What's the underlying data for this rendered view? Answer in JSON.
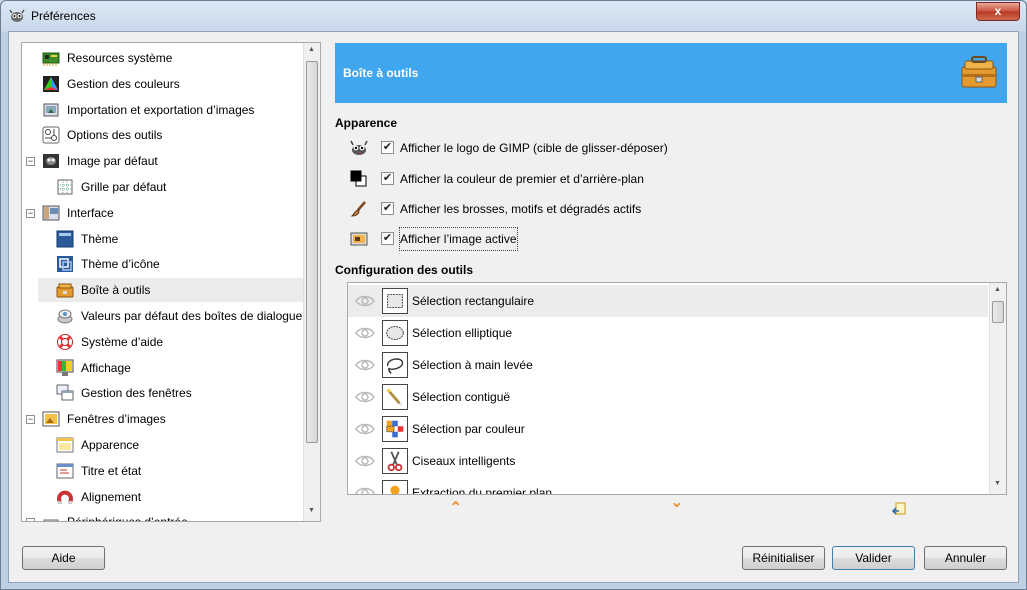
{
  "window": {
    "title": "Préférences",
    "close_label": "x"
  },
  "tree": {
    "items": [
      {
        "label": "Resources système",
        "icon": "chip-icon"
      },
      {
        "label": "Gestion des couleurs",
        "icon": "color-management-icon"
      },
      {
        "label": "Importation et exportation d’images",
        "icon": "import-export-icon"
      },
      {
        "label": "Options des outils",
        "icon": "tool-options-icon"
      },
      {
        "label": "Image par défaut",
        "icon": "default-image-icon",
        "expander": "−"
      },
      {
        "label": "Grille par défaut",
        "icon": "grid-icon"
      },
      {
        "label": "Interface",
        "icon": "interface-icon",
        "expander": "−"
      },
      {
        "label": "Thème",
        "icon": "theme-icon"
      },
      {
        "label": "Thème d’icône",
        "icon": "icon-theme-icon"
      },
      {
        "label": "Boîte à outils",
        "icon": "toolbox-icon",
        "selected": true
      },
      {
        "label": "Valeurs par défaut des boîtes de dialogue",
        "icon": "dialog-defaults-icon"
      },
      {
        "label": "Système d’aide",
        "icon": "help-lifebuoy-icon"
      },
      {
        "label": "Affichage",
        "icon": "display-icon"
      },
      {
        "label": "Gestion des fenêtres",
        "icon": "window-management-icon"
      },
      {
        "label": "Fenêtres d’images",
        "icon": "image-windows-icon",
        "expander": "−"
      },
      {
        "label": "Apparence",
        "icon": "appearance-icon"
      },
      {
        "label": "Titre et état",
        "icon": "title-status-icon"
      },
      {
        "label": "Alignement",
        "icon": "magnet-icon"
      },
      {
        "label": "Périphériques d’entrée",
        "icon": "input-devices-icon",
        "expander": "−"
      }
    ]
  },
  "banner": {
    "title": "Boîte à outils",
    "icon": "toolbox-icon",
    "color": "#3fa6ef"
  },
  "appearance": {
    "title": "Apparence",
    "options": [
      {
        "label": "Afficher le logo de GIMP (cible de glisser-déposer)",
        "checked": true,
        "icon": "gimp-logo-icon"
      },
      {
        "label": "Afficher la couleur de premier et d’arrière-plan",
        "checked": true,
        "icon": "fg-bg-color-icon"
      },
      {
        "label": "Afficher les brosses, motifs et dégradés actifs",
        "checked": true,
        "icon": "brush-icon"
      },
      {
        "label": "Afficher l’image active",
        "checked": true,
        "icon": "active-image-icon"
      }
    ],
    "check_mark": "✔"
  },
  "tools": {
    "title": "Configuration des outils",
    "items": [
      {
        "label": "Sélection rectangulaire",
        "icon": "rect-select-icon",
        "selected": true
      },
      {
        "label": "Sélection elliptique",
        "icon": "ellipse-select-icon"
      },
      {
        "label": "Sélection à main levée",
        "icon": "free-select-icon"
      },
      {
        "label": "Sélection contiguë",
        "icon": "fuzzy-select-icon"
      },
      {
        "label": "Sélection par couleur",
        "icon": "color-select-icon"
      },
      {
        "label": "Ciseaux intelligents",
        "icon": "scissors-icon"
      },
      {
        "label": "Extraction du premier plan",
        "icon": "foreground-select-icon"
      }
    ],
    "up_glyph": "⌃",
    "down_glyph": "⌄"
  },
  "buttons": {
    "help": "Aide",
    "reset": "Réinitialiser",
    "ok": "Valider",
    "cancel": "Annuler"
  }
}
